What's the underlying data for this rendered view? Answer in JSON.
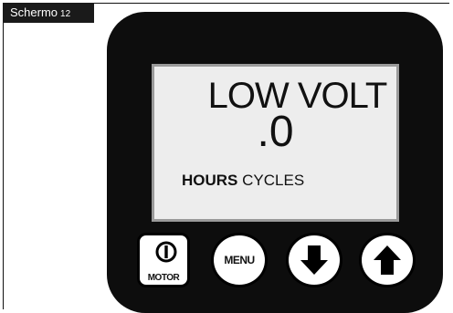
{
  "label": {
    "text": "Schermo",
    "number": "12"
  },
  "display": {
    "line1": "LOW VOLT",
    "line2": ".0",
    "hours": "HOURS",
    "cycles": "CYCLES"
  },
  "buttons": {
    "motor_label": "MOTOR",
    "menu_label": "MENU"
  },
  "colors": {
    "device": "#0d0d0d",
    "screen": "#ededed",
    "button": "#ffffff"
  },
  "icons": {
    "motor": "power-icon",
    "down": "arrow-down-icon",
    "up": "arrow-up-icon"
  }
}
